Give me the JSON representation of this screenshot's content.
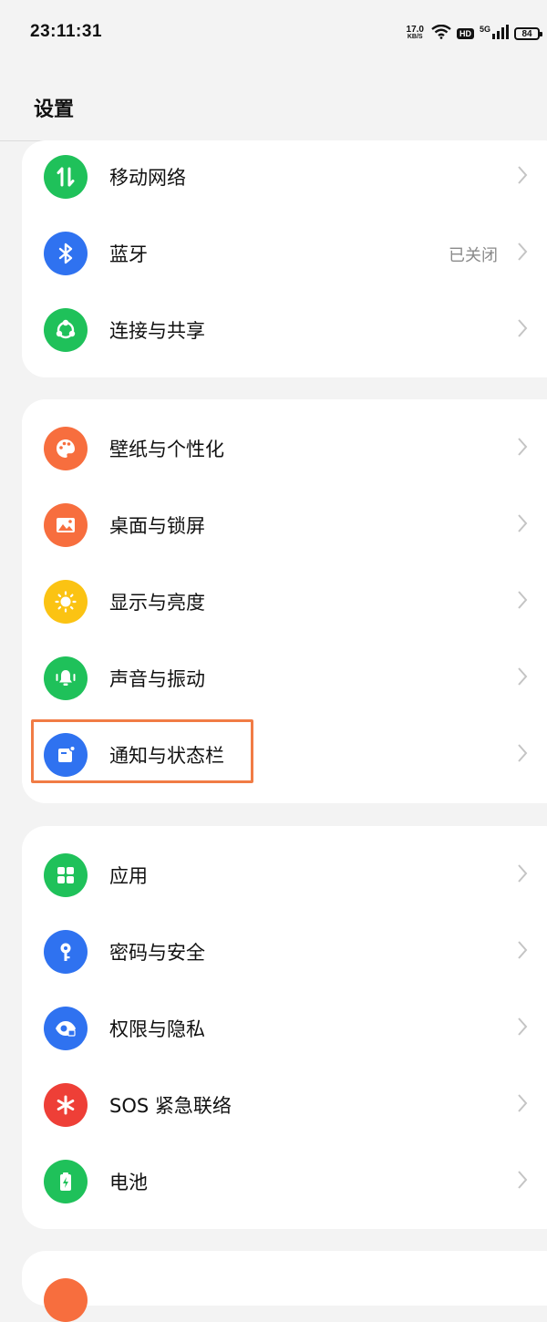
{
  "status_bar": {
    "time": "23:11:31",
    "net_speed_value": "17.0",
    "net_speed_unit": "KB/S",
    "hd": "HD",
    "network": "5G",
    "battery": "84"
  },
  "header": {
    "title": "设置"
  },
  "groups": [
    {
      "items": [
        {
          "label": "移动网络",
          "icon": "mobile-data-icon",
          "color": "#1fc15a",
          "value": ""
        },
        {
          "label": "蓝牙",
          "icon": "bluetooth-icon",
          "color": "#2f72f0",
          "value": "已关闭"
        },
        {
          "label": "连接与共享",
          "icon": "share-icon",
          "color": "#1fc15a",
          "value": ""
        }
      ]
    },
    {
      "items": [
        {
          "label": "壁纸与个性化",
          "icon": "palette-icon",
          "color": "#f76e3e",
          "value": ""
        },
        {
          "label": "桌面与锁屏",
          "icon": "image-icon",
          "color": "#f76e3e",
          "value": ""
        },
        {
          "label": "显示与亮度",
          "icon": "sun-icon",
          "color": "#fbc313",
          "value": ""
        },
        {
          "label": "声音与振动",
          "icon": "bell-icon",
          "color": "#1fc15a",
          "value": ""
        },
        {
          "label": "通知与状态栏",
          "icon": "notification-icon",
          "color": "#2f72f0",
          "value": ""
        }
      ]
    },
    {
      "items": [
        {
          "label": "应用",
          "icon": "apps-grid-icon",
          "color": "#1fc15a",
          "value": ""
        },
        {
          "label": "密码与安全",
          "icon": "key-icon",
          "color": "#2f72f0",
          "value": ""
        },
        {
          "label": "权限与隐私",
          "icon": "privacy-eye-icon",
          "color": "#2f72f0",
          "value": ""
        },
        {
          "label": "SOS 紧急联络",
          "icon": "sos-asterisk-icon",
          "color": "#ee3f37",
          "value": ""
        },
        {
          "label": "电池",
          "icon": "battery-icon",
          "color": "#1fc15a",
          "value": ""
        }
      ]
    }
  ],
  "highlight_color": "#f17c45"
}
